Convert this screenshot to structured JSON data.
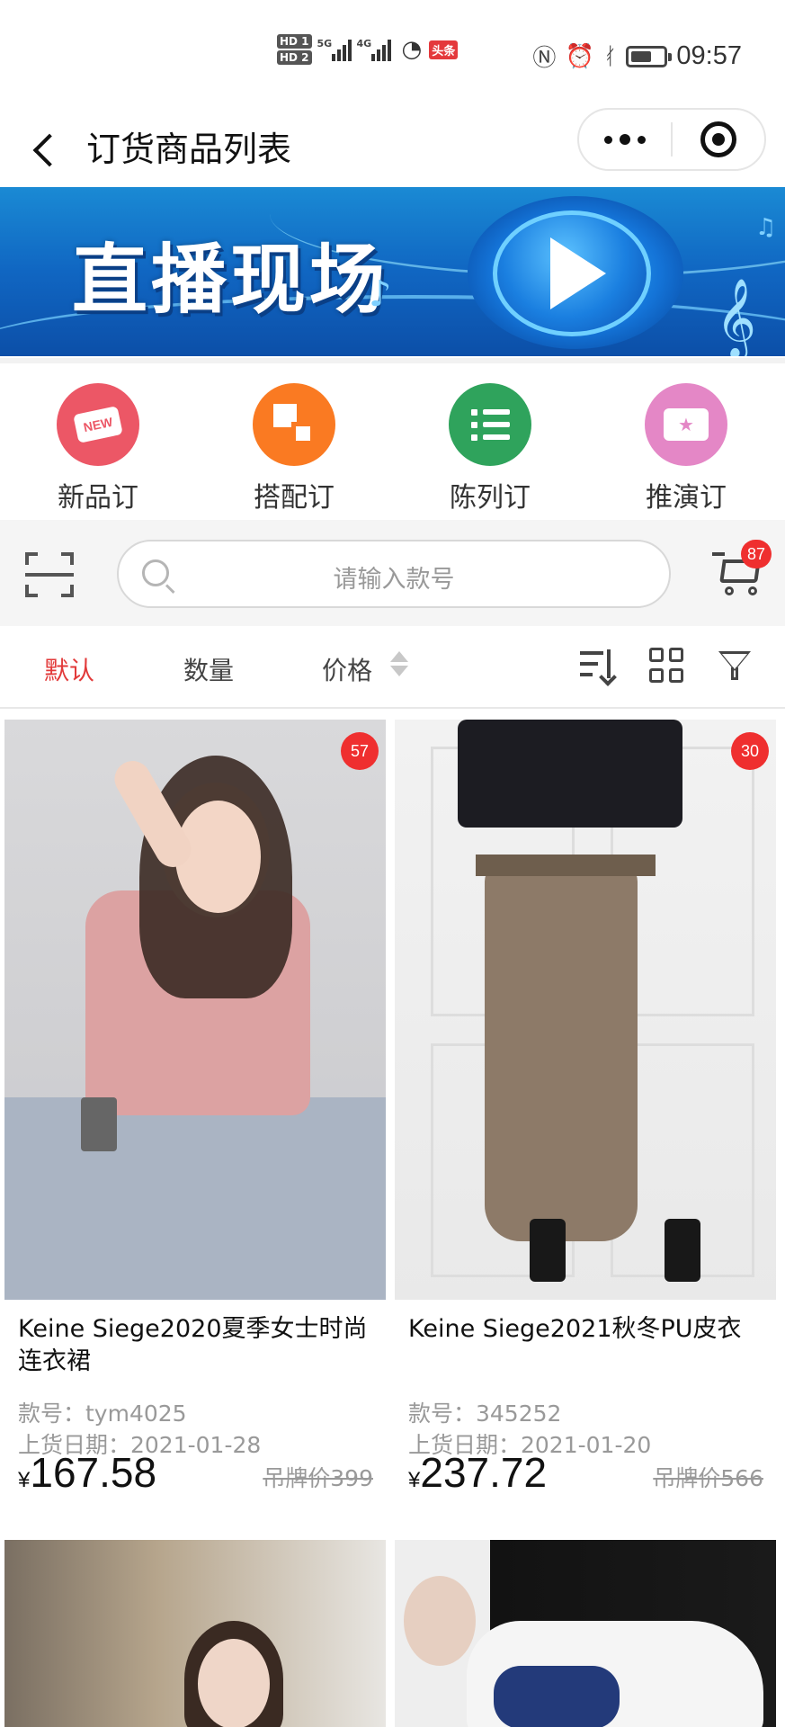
{
  "status_bar": {
    "hd_labels": [
      "HD 1",
      "HD 2"
    ],
    "net1": "5G",
    "net2": "4G",
    "toutiao": "头条",
    "time": "09:57",
    "icons": [
      "nfc-icon",
      "alarm-icon",
      "bluetooth-icon",
      "battery-icon"
    ]
  },
  "nav": {
    "title": "订货商品列表"
  },
  "banner": {
    "text": "直播现场"
  },
  "categories": [
    {
      "label": "新品订",
      "icon": "new-tag-icon",
      "color": "#ec5766",
      "icon_text": "NEW"
    },
    {
      "label": "搭配订",
      "icon": "match-icon",
      "color": "#fa7a22"
    },
    {
      "label": "陈列订",
      "icon": "list-icon",
      "color": "#2fa35c"
    },
    {
      "label": "推演订",
      "icon": "ticket-icon",
      "color": "#e487c6"
    }
  ],
  "search": {
    "placeholder": "请输入款号",
    "cart_badge": "87"
  },
  "sort": {
    "default": "默认",
    "quantity": "数量",
    "price": "价格"
  },
  "products": [
    {
      "name": "Keine Siege2020夏季女士时尚连衣裙",
      "style_label": "款号：tym4025",
      "date_label": "上货日期：2021-01-28",
      "currency": "¥",
      "price": "167.58",
      "tag_price": "吊牌价399",
      "count": "57"
    },
    {
      "name": "Keine Siege2021秋冬PU皮衣",
      "style_label": "款号：345252",
      "date_label": "上货日期：2021-01-20",
      "currency": "¥",
      "price": "237.72",
      "tag_price": "吊牌价566",
      "count": "30"
    }
  ],
  "colors": {
    "accent_red": "#e23a3a",
    "badge_red": "#ef2f2f",
    "banner_blue": "#1066c2"
  }
}
